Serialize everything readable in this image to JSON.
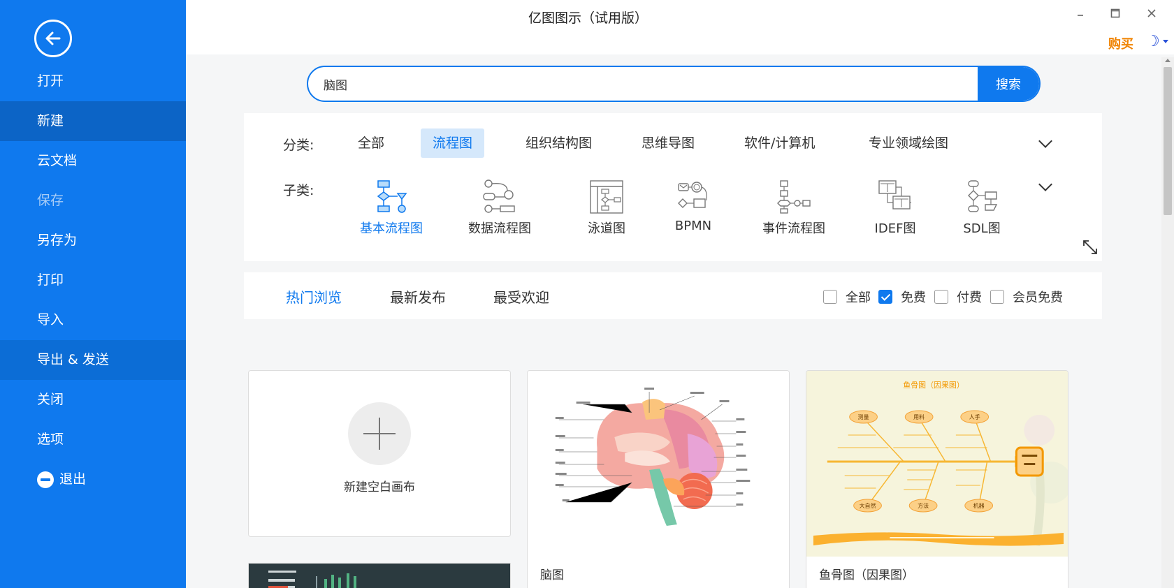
{
  "window": {
    "title": "亿图图示（试用版）",
    "buy_label": "购买"
  },
  "sidebar": {
    "items": [
      {
        "label": "打开"
      },
      {
        "label": "新建"
      },
      {
        "label": "云文档"
      },
      {
        "label": "保存"
      },
      {
        "label": "另存为"
      },
      {
        "label": "打印"
      },
      {
        "label": "导入"
      },
      {
        "label": "导出 & 发送"
      },
      {
        "label": "关闭"
      },
      {
        "label": "选项"
      },
      {
        "label": "退出"
      }
    ]
  },
  "search": {
    "value": "脑图",
    "button_label": "搜索"
  },
  "categories": {
    "label": "分类:",
    "items": [
      "全部",
      "流程图",
      "组织结构图",
      "思维导图",
      "软件/计算机",
      "专业领域绘图"
    ],
    "active": "流程图"
  },
  "subcategories": {
    "label": "子类:",
    "items": [
      "基本流程图",
      "数据流程图",
      "泳道图",
      "BPMN",
      "事件流程图",
      "IDEF图",
      "SDL图"
    ],
    "active": "基本流程图"
  },
  "filter": {
    "tabs": [
      "热门浏览",
      "最新发布",
      "最受欢迎"
    ],
    "active_tab": "热门浏览",
    "checkboxes": [
      {
        "label": "全部",
        "checked": false
      },
      {
        "label": "免费",
        "checked": true
      },
      {
        "label": "付费",
        "checked": false
      },
      {
        "label": "会员免费",
        "checked": false
      }
    ]
  },
  "templates": {
    "new_blank_label": "新建空白画布",
    "items": [
      {
        "title": "脑图"
      },
      {
        "title": "鱼骨图（因果图）"
      }
    ]
  },
  "thumbnails": {
    "fishbone": {
      "title": "鱼骨图（因果图）",
      "causes": [
        "测量",
        "用料",
        "人手",
        "大自然",
        "方法",
        "机器"
      ]
    }
  },
  "colors": {
    "accent": "#0f79ee",
    "sidebar": "#0f79ee",
    "buy": "#f08300"
  }
}
